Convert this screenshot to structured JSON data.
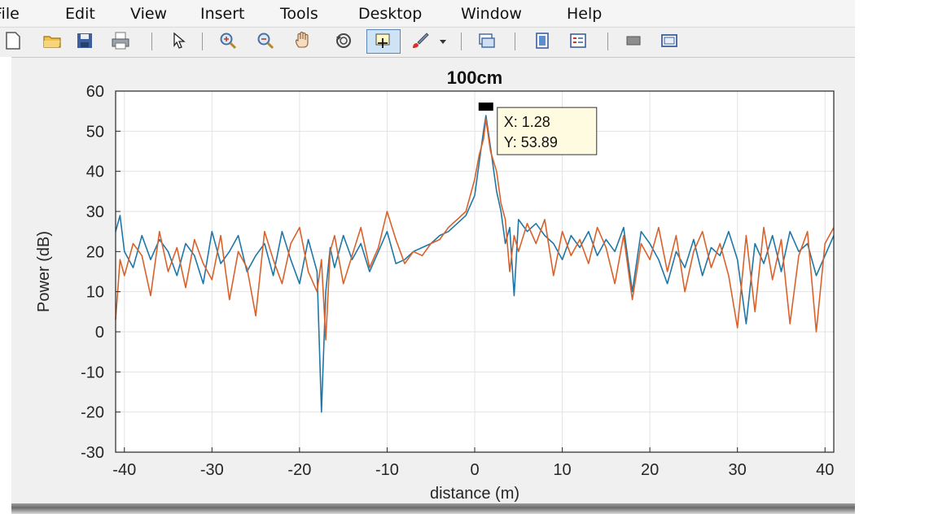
{
  "menu": [
    "File",
    "Edit",
    "View",
    "Insert",
    "Tools",
    "Desktop",
    "Window",
    "Help"
  ],
  "toolbar_icons": [
    "new-file-icon",
    "open-folder-icon",
    "save-icon",
    "print-icon",
    "pointer-icon",
    "zoom-in-icon",
    "zoom-out-icon",
    "pan-hand-icon",
    "rotate-3d-icon",
    "data-cursor-icon",
    "brush-icon",
    "dropdown-arrow-icon",
    "link-plot-icon",
    "colorbar-icon",
    "legend-icon",
    "hide-plot-tools-icon",
    "show-plot-tools-icon"
  ],
  "colors": {
    "series1": "#1f77a8",
    "series2": "#d9622b",
    "grid": "#e3e3e3",
    "axes": "#262626"
  },
  "datatip": {
    "x_label": "X: 1.28",
    "y_label": "Y: 53.89"
  },
  "chart_data": {
    "type": "line",
    "title": "100cm",
    "xlabel": "distance (m)",
    "ylabel": "Power (dB)",
    "xlim": [
      -41,
      41
    ],
    "ylim": [
      -30,
      60
    ],
    "xticks": [
      -40,
      -30,
      -20,
      -10,
      0,
      10,
      20,
      30,
      40
    ],
    "yticks": [
      -30,
      -20,
      -10,
      0,
      10,
      20,
      30,
      40,
      50,
      60
    ],
    "grid": true,
    "datatip_point": {
      "x": 1.28,
      "y": 53.89
    },
    "series": [
      {
        "color": "blue",
        "x": [
          -41,
          -40.5,
          -40,
          -39,
          -38,
          -37,
          -36,
          -35,
          -34,
          -33,
          -32,
          -31,
          -30,
          -29,
          -28,
          -27,
          -26,
          -25,
          -24,
          -23,
          -22,
          -21,
          -20,
          -19,
          -18,
          -17.5,
          -17,
          -16.5,
          -16,
          -15,
          -14,
          -13,
          -12,
          -11,
          -10,
          -9,
          -8,
          -7,
          -6,
          -5,
          -4,
          -3,
          -2,
          -1,
          0,
          0.5,
          1,
          1.28,
          1.8,
          2.5,
          3,
          3.5,
          4,
          4.5,
          5,
          6,
          7,
          8,
          9,
          10,
          11,
          12,
          13,
          14,
          15,
          16,
          17,
          18,
          19,
          20,
          21,
          22,
          23,
          24,
          25,
          26,
          27,
          28,
          29,
          30,
          31,
          32,
          33,
          34,
          35,
          36,
          37,
          38,
          39,
          40,
          41
        ],
        "values": [
          25,
          29,
          20,
          16,
          24,
          18,
          23,
          20,
          14,
          22,
          19,
          12,
          25,
          17,
          20,
          24,
          15,
          19,
          22,
          14,
          25,
          18,
          12,
          23,
          15,
          -20,
          10,
          21,
          16,
          24,
          18,
          22,
          15,
          20,
          25,
          17,
          18,
          20,
          21,
          22,
          24,
          25,
          27,
          29,
          34,
          42,
          50,
          53.89,
          46,
          35,
          30,
          22,
          26,
          9,
          28,
          25,
          27,
          24,
          22,
          18,
          24,
          21,
          25,
          19,
          23,
          20,
          26,
          10,
          25,
          22,
          18,
          12,
          20,
          16,
          23,
          14,
          21,
          19,
          25,
          18,
          2,
          22,
          17,
          24,
          15,
          25,
          20,
          22,
          14,
          19,
          24
        ]
      },
      {
        "color": "orange",
        "x": [
          -41,
          -40.5,
          -40,
          -39,
          -38,
          -37,
          -36,
          -35,
          -34,
          -33,
          -32,
          -31,
          -30,
          -29,
          -28,
          -27,
          -26,
          -25,
          -24,
          -23,
          -22,
          -21,
          -20,
          -19,
          -18,
          -17.5,
          -17,
          -16.5,
          -16,
          -15,
          -14,
          -13,
          -12,
          -11,
          -10,
          -9,
          -8,
          -7,
          -6,
          -5,
          -4,
          -3,
          -2,
          -1,
          0,
          0.5,
          1,
          1.28,
          1.8,
          2.5,
          3,
          3.5,
          4,
          4.5,
          5,
          6,
          7,
          8,
          9,
          10,
          11,
          12,
          13,
          14,
          15,
          16,
          17,
          18,
          19,
          20,
          21,
          22,
          23,
          24,
          25,
          26,
          27,
          28,
          29,
          30,
          31,
          32,
          33,
          34,
          35,
          36,
          37,
          38,
          39,
          40,
          41
        ],
        "values": [
          3,
          18,
          14,
          22,
          19,
          9,
          25,
          15,
          21,
          11,
          23,
          17,
          13,
          24,
          8,
          20,
          16,
          4,
          25,
          18,
          12,
          22,
          26,
          15,
          10,
          18,
          -2,
          20,
          24,
          12,
          19,
          26,
          16,
          21,
          30,
          23,
          17,
          20,
          19,
          22,
          23,
          26,
          28,
          30,
          38,
          44,
          48,
          53,
          45,
          40,
          32,
          28,
          15,
          24,
          20,
          27,
          22,
          28,
          14,
          25,
          19,
          23,
          17,
          26,
          21,
          12,
          24,
          8,
          22,
          18,
          26,
          15,
          24,
          10,
          20,
          25,
          16,
          22,
          14,
          1,
          24,
          5,
          26,
          13,
          23,
          2,
          19,
          25,
          0,
          22,
          26
        ]
      }
    ]
  }
}
